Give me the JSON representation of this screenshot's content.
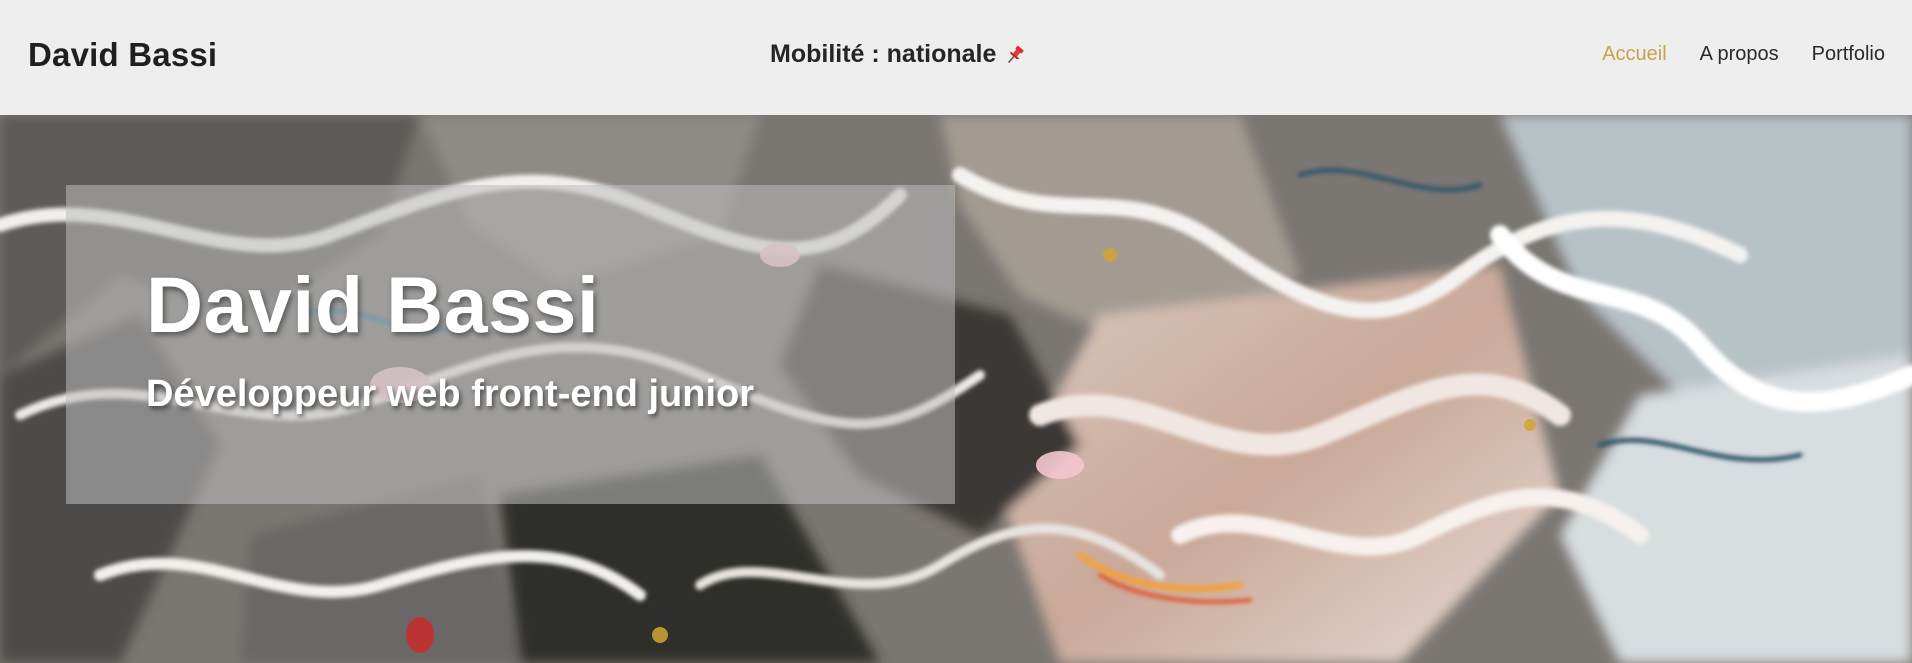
{
  "header": {
    "brand": "David Bassi",
    "mobility": "Mobilité : nationale",
    "mobility_icon": "pushpin-icon",
    "nav": [
      {
        "label": "Accueil",
        "active": true
      },
      {
        "label": "A propos",
        "active": false
      },
      {
        "label": "Portfolio",
        "active": false
      }
    ]
  },
  "hero": {
    "title": "David Bassi",
    "subtitle": "Développeur web front-end junior",
    "background": "marble-abstract-image"
  },
  "colors": {
    "header_bg": "#eeeeee",
    "brand_text": "#1f1f1f",
    "nav_active": "#c9a24c",
    "nav_text": "#2a2a2a",
    "hero_text": "#ffffff"
  }
}
